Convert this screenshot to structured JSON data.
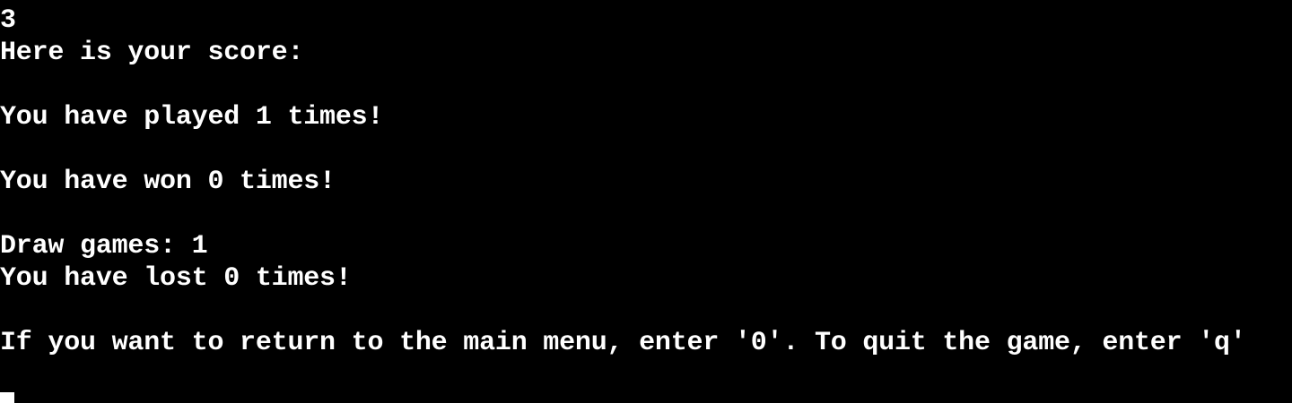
{
  "terminal": {
    "lines": [
      "3",
      "Here is your score:",
      "",
      "You have played 1 times!",
      "",
      "You have won 0 times!",
      "",
      "Draw games: 1",
      "You have lost 0 times!",
      "",
      "If you want to return to the main menu, enter '0'. To quit the game, enter 'q'"
    ]
  }
}
